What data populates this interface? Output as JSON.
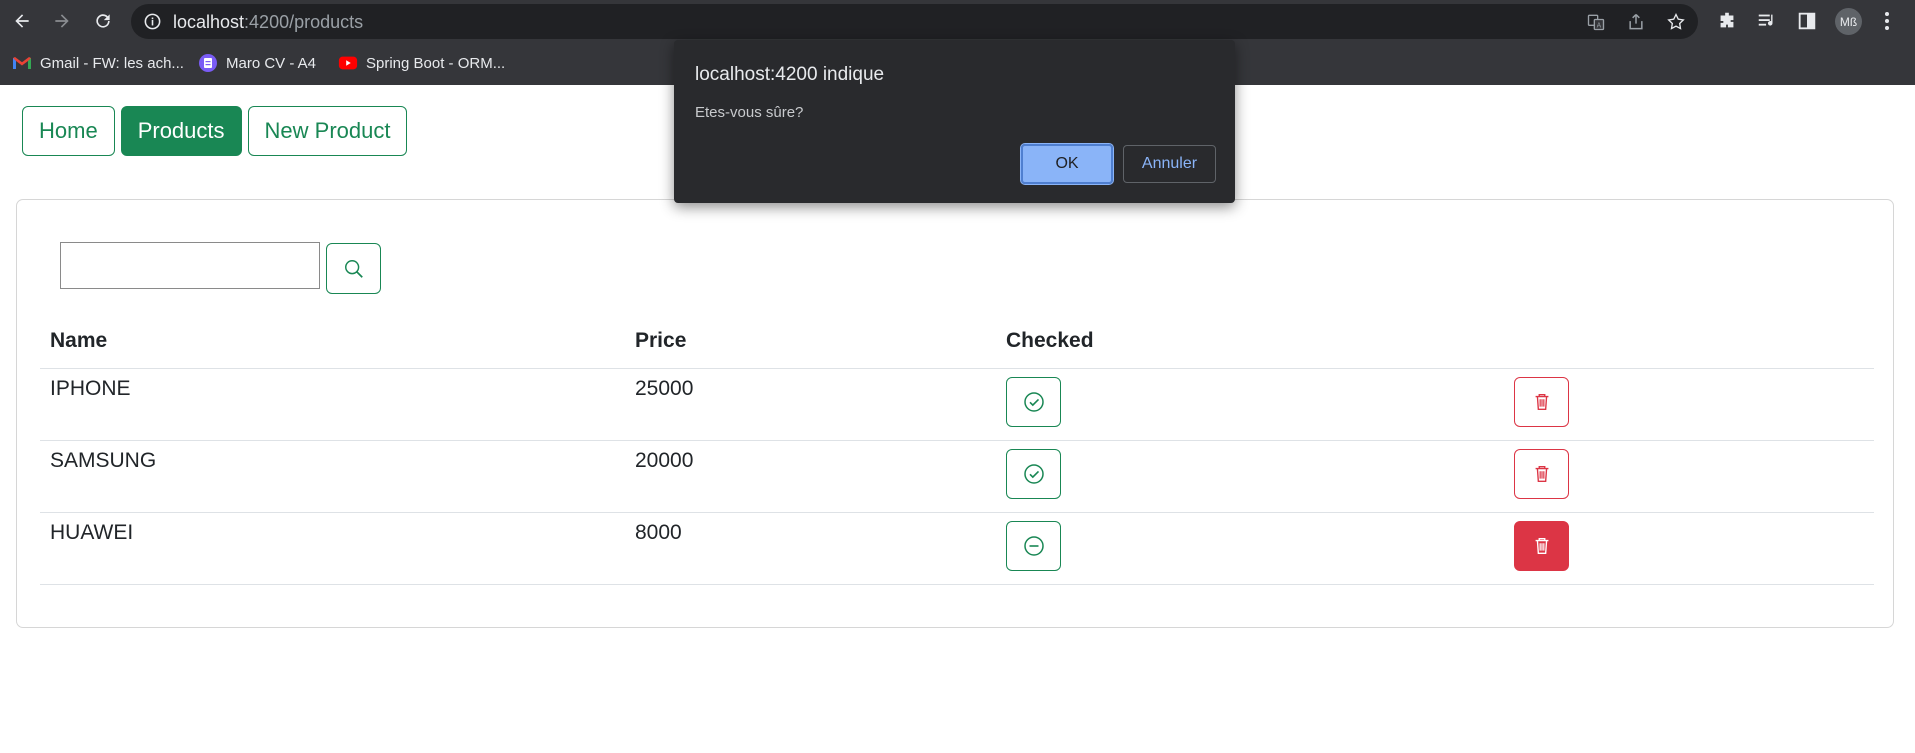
{
  "browser": {
    "url_host": "localhost",
    "url_path": ":4200/products",
    "avatar_initials": "Mß",
    "bookmarks": [
      {
        "label": "Gmail - FW: les ach...",
        "icon": "gmail-icon"
      },
      {
        "label": "Maro CV - A4",
        "icon": "docs-icon"
      },
      {
        "label": "Spring Boot - ORM...",
        "icon": "youtube-icon"
      }
    ]
  },
  "nav": {
    "links": [
      {
        "label": "Home",
        "active": false
      },
      {
        "label": "Products",
        "active": true
      },
      {
        "label": "New Product",
        "active": false
      }
    ]
  },
  "search": {
    "value": "",
    "placeholder": ""
  },
  "table": {
    "headers": [
      "Name",
      "Price",
      "Checked"
    ],
    "rows": [
      {
        "name": "IPHONE",
        "price": "25000",
        "checked": true
      },
      {
        "name": "SAMSUNG",
        "price": "20000",
        "checked": true
      },
      {
        "name": "HUAWEI",
        "price": "8000",
        "checked": false
      }
    ]
  },
  "dialog": {
    "title": "localhost:4200 indique",
    "message": "Etes-vous sûre?",
    "ok_label": "OK",
    "cancel_label": "Annuler"
  },
  "colors": {
    "success": "#198754",
    "danger": "#dc3545",
    "chrome_bg": "#35363a",
    "dialog_bg": "#292a2d",
    "dialog_accent": "#8ab4f8"
  }
}
